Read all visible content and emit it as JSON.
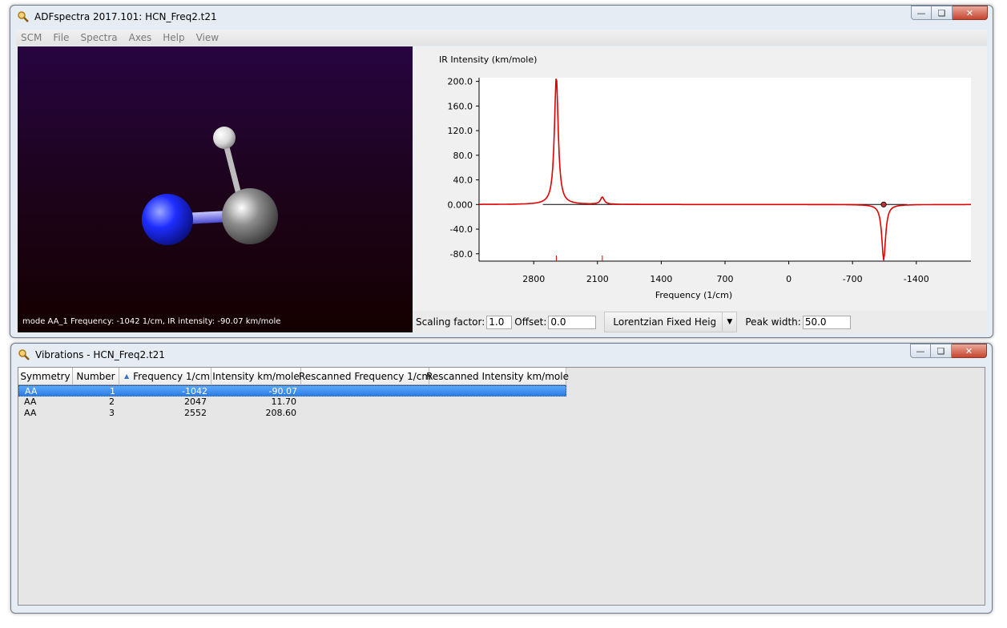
{
  "main_window": {
    "title": "ADFspectra 2017.101: HCN_Freq2.t21",
    "icon": "magnifier-icon",
    "menu": [
      "SCM",
      "File",
      "Spectra",
      "Axes",
      "Help",
      "View"
    ]
  },
  "molecule_viewer": {
    "status": "mode AA_1 Frequency: -1042 1/cm, IR intensity: -90.07 km/mole"
  },
  "chart_data": {
    "type": "line",
    "title": "",
    "ylabel": "IR Intensity (km/mole)",
    "xlabel": "Frequency (1/cm)",
    "x_axis_reversed": true,
    "xlim": [
      3400,
      -2000
    ],
    "ylim": [
      -92,
      206
    ],
    "x_ticks": [
      2800,
      2100,
      1400,
      700,
      0,
      -700,
      -1400
    ],
    "y_ticks": [
      "200.0",
      "160.0",
      "120.0",
      "80.0",
      "40.0",
      "0.000",
      "-40.0",
      "-80.0"
    ],
    "y_tick_values": [
      200,
      160,
      120,
      80,
      40,
      0,
      -40,
      -80
    ],
    "peaks": [
      {
        "frequency": 2552,
        "intensity": 208.6
      },
      {
        "frequency": 2047,
        "intensity": 11.7
      },
      {
        "frequency": -1042,
        "intensity": -90.07
      }
    ],
    "peak_width": 50.0,
    "line_shape": "Lorentzian",
    "series_color": "#e00000",
    "selected_peak": -1042,
    "grid": false
  },
  "controls": {
    "scaling_label": "Scaling factor:",
    "scaling_value": "1.0",
    "offset_label": "Offset:",
    "offset_value": "0.0",
    "lineshape_value": "Lorentzian Fixed Heigh",
    "peakwidth_label": "Peak width:",
    "peakwidth_value": "50.0"
  },
  "vibrations_window": {
    "title": "Vibrations - HCN_Freq2.t21",
    "icon": "magnifier-icon",
    "columns": [
      "Symmetry",
      "Number",
      "Frequency 1/cm",
      "Intensity km/mole",
      "Rescanned Frequency 1/cm",
      "Rescanned Intensity km/mole"
    ],
    "rows": [
      {
        "symmetry": "AA",
        "number": "1",
        "frequency": "-1042",
        "intensity": "-90.07"
      },
      {
        "symmetry": "AA",
        "number": "2",
        "frequency": "2047",
        "intensity": "11.70"
      },
      {
        "symmetry": "AA",
        "number": "3",
        "frequency": "2552",
        "intensity": "208.60"
      }
    ]
  }
}
